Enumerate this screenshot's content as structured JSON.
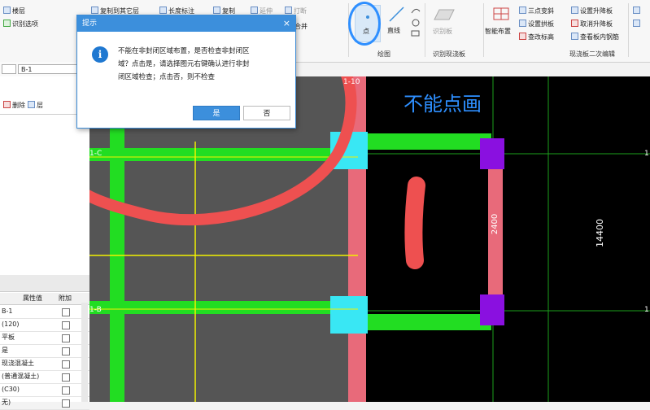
{
  "ribbon": {
    "items": {
      "copy_to_other_layer": "复制到其它层",
      "length_label": "长度标注",
      "copy": "复制",
      "extend": "延伸",
      "break": "打断",
      "merge": "合并",
      "id_options": "识别选项",
      "layer_mgmt": "楼层",
      "point": "点",
      "line": "直线",
      "identify_slab": "识别板",
      "smart_layout": "智能布置",
      "three_point_slope": "三点变斜",
      "set_arch_slab": "设置拱板",
      "check_edit_elevation": "查改标高",
      "set_lift_slab": "设置升降板",
      "cancel_lift_slab": "取消升降板",
      "view_slab_rebar": "查看板内钢筋"
    },
    "groups": {
      "draw": "绘图",
      "identify": "识别现浇板",
      "secondary_edit": "现浇板二次编辑"
    }
  },
  "toolbar": {
    "combo_type": "",
    "combo_name": "B-1",
    "delete": "删除",
    "layer": "层"
  },
  "properties": {
    "col_value": "属性值",
    "col_attach": "附加",
    "rows": [
      {
        "value": "B-1"
      },
      {
        "value": "(120)"
      },
      {
        "value": "平板"
      },
      {
        "value": "是"
      },
      {
        "value": "现浇混凝土"
      },
      {
        "value": "(普通混凝土)"
      },
      {
        "value": "(C30)"
      },
      {
        "value": "无)"
      }
    ]
  },
  "dialog": {
    "title": "提示",
    "message_lines": [
      "不能在非封闭区域布置，是否检查非封闭区",
      "域？点击是，请选择图元右键确认进行非封",
      "闭区域检查；点击否，则不检查"
    ],
    "yes": "是",
    "no": "否",
    "close": "×"
  },
  "canvas": {
    "annotation": "不能点画",
    "dim_2400": "2400",
    "dim_14400": "14400",
    "axis_c": "1-C",
    "axis_b": "1-B",
    "axis_right_1": "1",
    "axis_right_2": "1",
    "axis_top": "1-10"
  },
  "colors": {
    "canvas_bg": "#000000",
    "wall_green": "#22dd22",
    "beam_pink": "#e86a7a",
    "column_purple": "#8a10e0",
    "cyan": "#39e7f4",
    "yellow_rebar": "#f2f200",
    "annotation_blue": "#2e8fff",
    "markup_red": "#ee5050"
  }
}
